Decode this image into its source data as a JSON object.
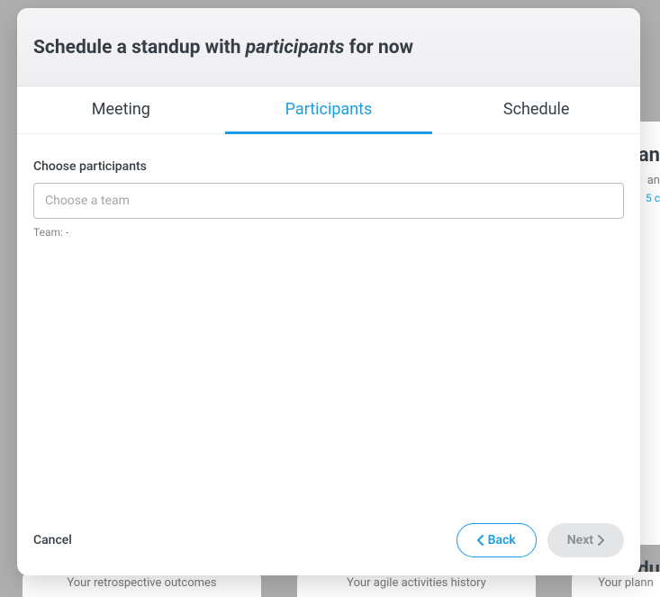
{
  "modal": {
    "title_pre": "Schedule a standup with ",
    "title_em": "participants",
    "title_post": " for now",
    "tabs": {
      "meeting": "Meeting",
      "participants": "Participants",
      "schedule": "Schedule"
    },
    "field": {
      "label": "Choose participants",
      "placeholder": "Choose a team",
      "helper_prefix": "Team: ",
      "helper_value": "-"
    },
    "footer": {
      "cancel": "Cancel",
      "back": "Back",
      "next": "Next"
    }
  },
  "background": {
    "right_heading": "an",
    "right_sub": "an",
    "right_link": "5 c",
    "right_heading_2": "edu",
    "card1": "Your retrospective outcomes",
    "card2": "Your agile activities history",
    "card3": "Your plann"
  }
}
